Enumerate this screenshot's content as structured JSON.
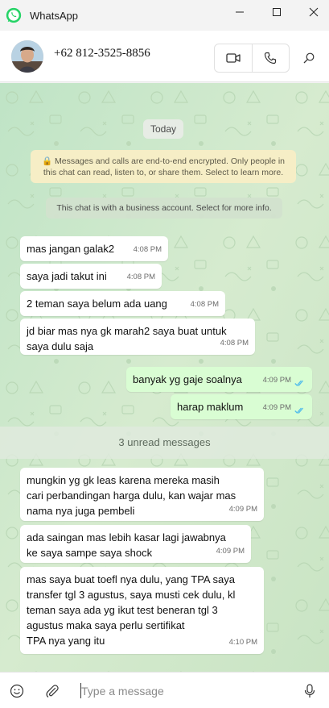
{
  "window": {
    "title": "WhatsApp",
    "minimize_icon": "minimize-icon",
    "maximize_icon": "maximize-icon",
    "close_icon": "close-icon"
  },
  "header": {
    "contact_name": "+62 812-3525-8856",
    "avatar_icon": "avatar-photo",
    "video_call_icon": "video-camera-icon",
    "voice_call_icon": "phone-icon",
    "search_icon": "search-icon"
  },
  "chat": {
    "date_divider": "Today",
    "encryption_notice_line1": "🔒 Messages and calls are end-to-end encrypted. Only people in",
    "encryption_notice_line2": "this chat can read, listen to, or share them. Select to learn more.",
    "business_notice": "This chat is with a business account. Select for more info.",
    "unread_label": "3 unread messages",
    "messages": [
      {
        "direction": "in",
        "lines": [
          "mas jangan galak2"
        ],
        "time": "4:08 PM"
      },
      {
        "direction": "in",
        "lines": [
          "saya jadi takut ini"
        ],
        "time": "4:08 PM"
      },
      {
        "direction": "in",
        "lines": [
          "2 teman saya belum ada uang"
        ],
        "time": "4:08 PM"
      },
      {
        "direction": "in",
        "lines": [
          "jd biar mas nya gk marah2 saya buat untuk",
          "saya dulu saja"
        ],
        "time": "4:08 PM"
      },
      {
        "direction": "out",
        "lines": [
          "banyak yg gaje soalnya"
        ],
        "time": "4:09 PM",
        "status": "read"
      },
      {
        "direction": "out",
        "lines": [
          "harap maklum"
        ],
        "time": "4:09 PM",
        "status": "read"
      },
      {
        "direction": "in",
        "lines": [
          "mungkin yg gk leas karena mereka masih",
          "cari perbandingan harga dulu, kan wajar mas",
          "nama nya juga pembeli"
        ],
        "time": "4:09 PM"
      },
      {
        "direction": "in",
        "lines": [
          "ada saingan mas lebih kasar lagi jawabnya",
          "ke saya sampe saya shock"
        ],
        "time": "4:09 PM"
      },
      {
        "direction": "in",
        "lines": [
          "mas saya buat toefl nya dulu,  yang TPA saya",
          "transfer tgl 3 agustus, saya musti cek dulu, kl",
          "teman saya ada yg ikut test beneran tgl 3",
          "agustus maka saya perlu sertifikat",
          "TPA nya yang itu"
        ],
        "time": "4:10 PM"
      }
    ]
  },
  "composer": {
    "placeholder": "Type a message",
    "emoji_icon": "emoji-icon",
    "attach_icon": "paperclip-icon",
    "mic_icon": "microphone-icon"
  },
  "colors": {
    "chat_background": "#cfe6cb",
    "incoming_bubble": "#ffffff",
    "outgoing_bubble": "#d9fdd3",
    "read_ticks": "#53bdeb",
    "brand_green": "#25d366"
  }
}
